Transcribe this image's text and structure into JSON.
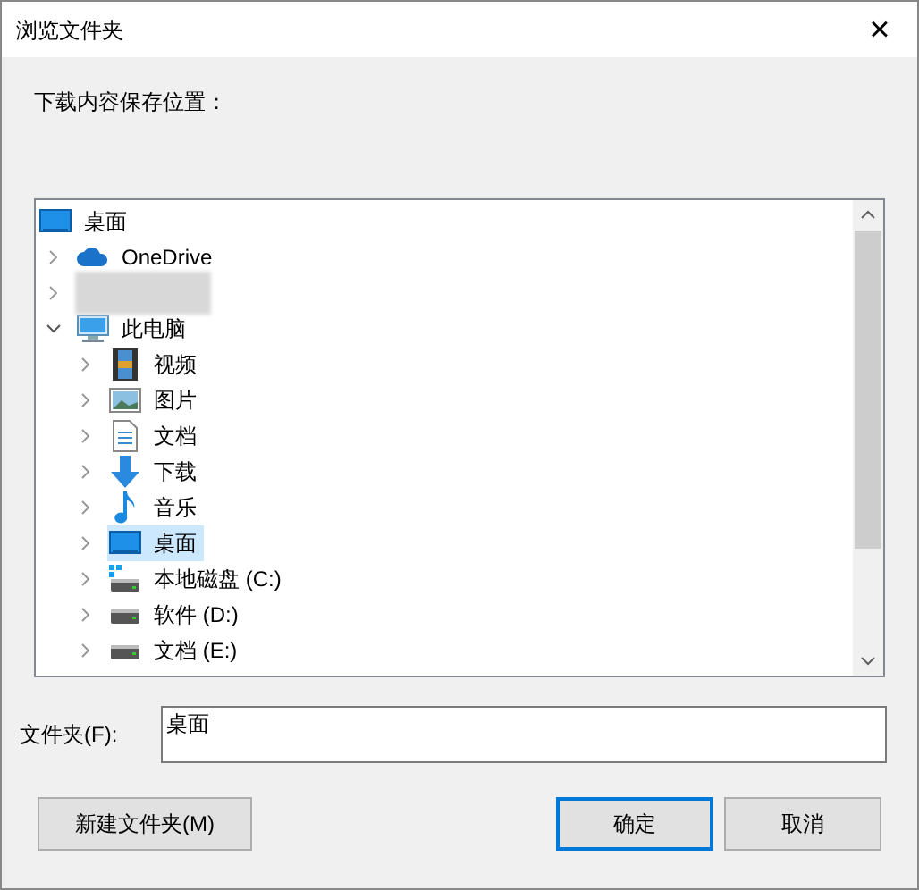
{
  "window": {
    "title": "浏览文件夹",
    "close": "×"
  },
  "prompt": "下载内容保存位置：",
  "tree": {
    "root": {
      "label": "桌面",
      "kind": "desktop",
      "selected": false
    },
    "items": [
      {
        "label": "OneDrive",
        "kind": "cloud",
        "expanded": false,
        "selected": false
      },
      {
        "kind": "redacted",
        "expanded": false
      },
      {
        "label": "此电脑",
        "kind": "pc",
        "expanded": true,
        "selected": false,
        "children": [
          {
            "label": "视频",
            "kind": "video",
            "expanded": false,
            "selected": false
          },
          {
            "label": "图片",
            "kind": "pictures",
            "expanded": false,
            "selected": false
          },
          {
            "label": "文档",
            "kind": "documents",
            "expanded": false,
            "selected": false
          },
          {
            "label": "下载",
            "kind": "downloads",
            "expanded": false,
            "selected": false
          },
          {
            "label": "音乐",
            "kind": "music",
            "expanded": false,
            "selected": false
          },
          {
            "label": "桌面",
            "kind": "desktop",
            "expanded": false,
            "selected": true
          },
          {
            "label": "本地磁盘 (C:)",
            "kind": "system-drive",
            "expanded": false,
            "selected": false
          },
          {
            "label": "软件 (D:)",
            "kind": "drive",
            "expanded": false,
            "selected": false
          },
          {
            "label": "文档 (E:)",
            "kind": "drive",
            "expanded": false,
            "selected": false
          }
        ]
      }
    ]
  },
  "folder": {
    "label": "文件夹(F):",
    "value": "桌面"
  },
  "buttons": [
    {
      "label": "新建文件夹(M)",
      "kind": "secondary",
      "focused": false,
      "disabled": false
    },
    {
      "label": "确定",
      "kind": "primary",
      "focused": true,
      "disabled": false
    },
    {
      "label": "取消",
      "kind": "primary",
      "focused": false,
      "disabled": false
    }
  ]
}
